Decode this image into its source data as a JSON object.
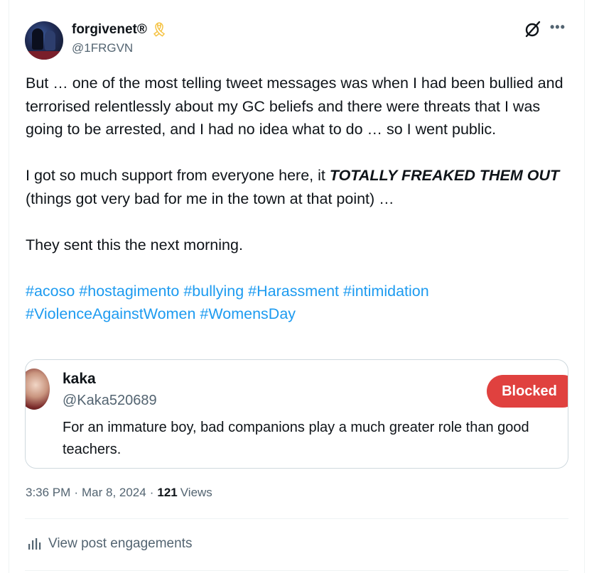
{
  "author": {
    "display_name": "forgivenet®",
    "badge_icon": "yellow-ribbon-icon",
    "handle": "@1FRGVN"
  },
  "header_icons": [
    "grok-icon",
    "more-icon"
  ],
  "post": {
    "paragraph1": "But … one of the most telling tweet messages was when I had been bullied and terrorised relentlessly about my GC beliefs and there were threats that I was going to be arrested, and I had no idea what to do … so I went public.",
    "paragraph2_start": "I got so much support from everyone here, it ",
    "paragraph2_emphasis": "TOTALLY FREAKED THEM OUT",
    "paragraph2_end": "  (things got very bad for me in the town at that point) …",
    "paragraph3": "They sent this the next morning.",
    "hashtags": "#acoso #hostagimento #bullying #Harassment #intimidation #ViolenceAgainstWomen #WomensDay"
  },
  "embedded_card": {
    "name": "kaka",
    "handle": "@Kaka520689",
    "blocked_label": "Blocked",
    "text": "For an immature boy, bad companions play a much greater role than good teachers."
  },
  "meta": {
    "time": "3:36 PM",
    "separator": "·",
    "date": "Mar 8, 2024",
    "views_count": "121",
    "views_label": "Views"
  },
  "engagements_label": "View post engagements",
  "colors": {
    "link": "#1d9bf0",
    "secondary_text": "#536471",
    "blocked_bg": "#e0413f",
    "ribbon": "#f5c242"
  }
}
